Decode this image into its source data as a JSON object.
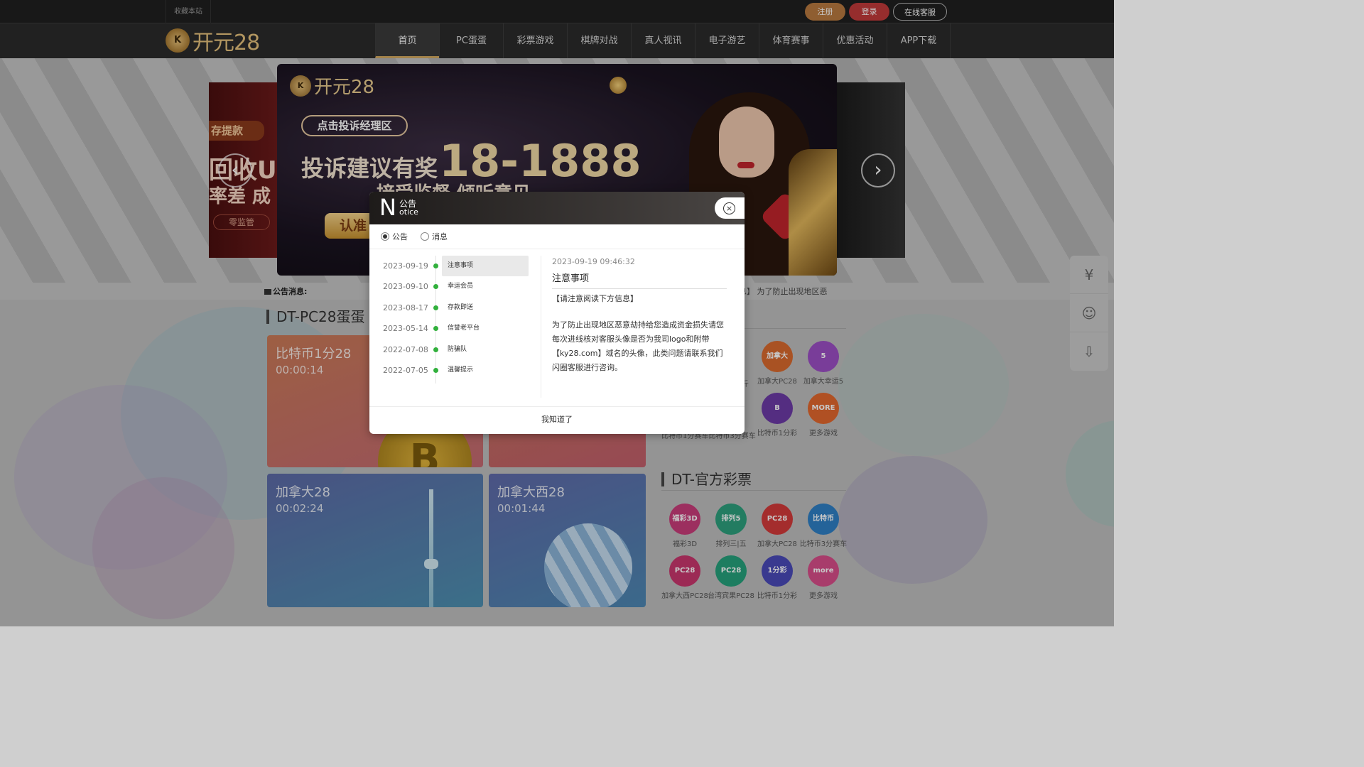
{
  "topbar": {
    "bookmark": "收藏本站",
    "register": "注册",
    "login": "登录",
    "service": "在线客服"
  },
  "logo": {
    "badge": "K",
    "text": "开元28"
  },
  "nav": [
    "首页",
    "PC蛋蛋",
    "彩票游戏",
    "棋牌对战",
    "真人视讯",
    "电子游艺",
    "体育赛事",
    "优惠活动",
    "APP下载"
  ],
  "banner": {
    "logo_text": "开元28",
    "tag": "点击投诉经理区",
    "headline_a": "投诉建议有奖",
    "headline_b": "18-1888",
    "sub": "接受监督 倾听意见",
    "pill": "认准",
    "side_tag": "存提款",
    "side_line1": "回收U",
    "side_line2": "率差 成",
    "side_badge": "零监管"
  },
  "announce": {
    "label": "公告消息:",
    "scroll": "息】 为了防止出现地区恶"
  },
  "sections": {
    "pc28": "DT-PC28蛋蛋",
    "hot": "票",
    "official": "DT-官方彩票"
  },
  "cards": [
    {
      "name": "比特币1分28",
      "time": "00:00:14"
    },
    {
      "name": "加拿大28",
      "time": "00:02:24"
    },
    {
      "name": "加拿大西28",
      "time": "00:01:44"
    }
  ],
  "coin_symbol": "B",
  "hot_games": [
    {
      "label": "加拿大PC28",
      "icon": "加拿大",
      "color": "#d9692e"
    },
    {
      "label": "加拿大幸运5",
      "icon": "5",
      "color": "#9c4fc4"
    },
    {
      "label": "比特币1分彩",
      "icon": "B",
      "color": "#6c3aa6"
    },
    {
      "label": "更多游戏",
      "icon": "MORE",
      "color": "#e2672e"
    }
  ],
  "hot_partial_labels": [
    "斤",
    "比特币1分赛车比特币3分赛车"
  ],
  "official_games": [
    {
      "label": "福彩3D",
      "icon": "福彩3D",
      "color": "#c83d7a"
    },
    {
      "label": "排列三|五",
      "icon": "排列5",
      "color": "#2e9f7d"
    },
    {
      "label": "加拿大PC28",
      "icon": "PC28",
      "color": "#d33a3a"
    },
    {
      "label": "比特币3分赛车",
      "icon": "比特币",
      "color": "#2f7fc4"
    },
    {
      "label": "加拿大西PC28",
      "icon": "PC28",
      "color": "#c8366d"
    },
    {
      "label": "台湾宾果PC28",
      "icon": "PC28",
      "color": "#26a07b"
    },
    {
      "label": "比特币1分彩",
      "icon": "1分彩",
      "color": "#4a4ab8"
    },
    {
      "label": "更多游戏",
      "icon": "more",
      "color": "#d84d8a"
    }
  ],
  "float_icons": [
    "money-bag-icon",
    "customer-service-icon",
    "download-icon"
  ],
  "modal": {
    "big_letter": "N",
    "title_cn": "公告",
    "title_en": "otice",
    "close": "×",
    "tabs": [
      "公告",
      "消息"
    ],
    "items": [
      {
        "date": "2023-09-19",
        "title": "注意事项"
      },
      {
        "date": "2023-09-10",
        "title": "幸运会员"
      },
      {
        "date": "2023-08-17",
        "title": "存款即送"
      },
      {
        "date": "2023-05-14",
        "title": "信誉老平台"
      },
      {
        "date": "2022-07-08",
        "title": "防骗队"
      },
      {
        "date": "2022-07-05",
        "title": "温馨提示"
      }
    ],
    "detail": {
      "timestamp": "2023-09-19 09:46:32",
      "title": "注意事项",
      "intro": "【请注意阅读下方信息】",
      "body": "为了防止出现地区恶意劫持给您造成资金损失请您每次进线核对客服头像是否为我司logo和附带【ky28.com】域名的头像，此类问题请联系我们闪圈客服进行咨询。"
    },
    "ok": "我知道了"
  }
}
